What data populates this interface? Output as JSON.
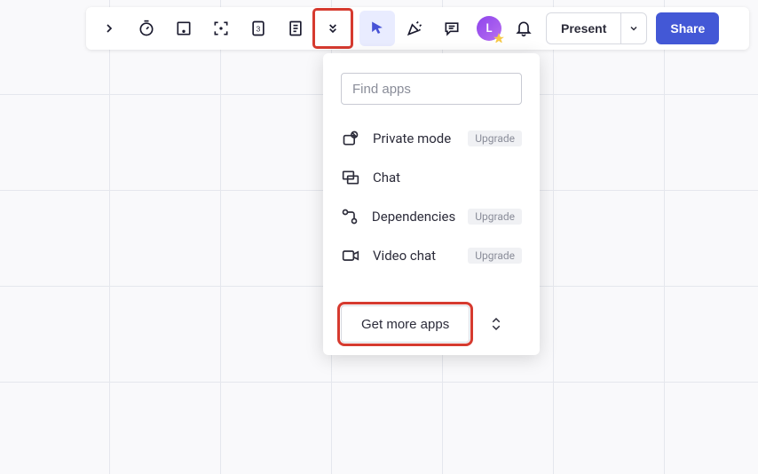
{
  "toolbar": {
    "present_label": "Present",
    "share_label": "Share",
    "avatar_initial": "L"
  },
  "apps_dropdown": {
    "search_placeholder": "Find apps",
    "items": [
      {
        "label": "Private mode",
        "badge": "Upgrade"
      },
      {
        "label": "Chat",
        "badge": ""
      },
      {
        "label": "Dependencies",
        "badge": "Upgrade"
      },
      {
        "label": "Video chat",
        "badge": "Upgrade"
      }
    ],
    "get_more_label": "Get more apps"
  }
}
